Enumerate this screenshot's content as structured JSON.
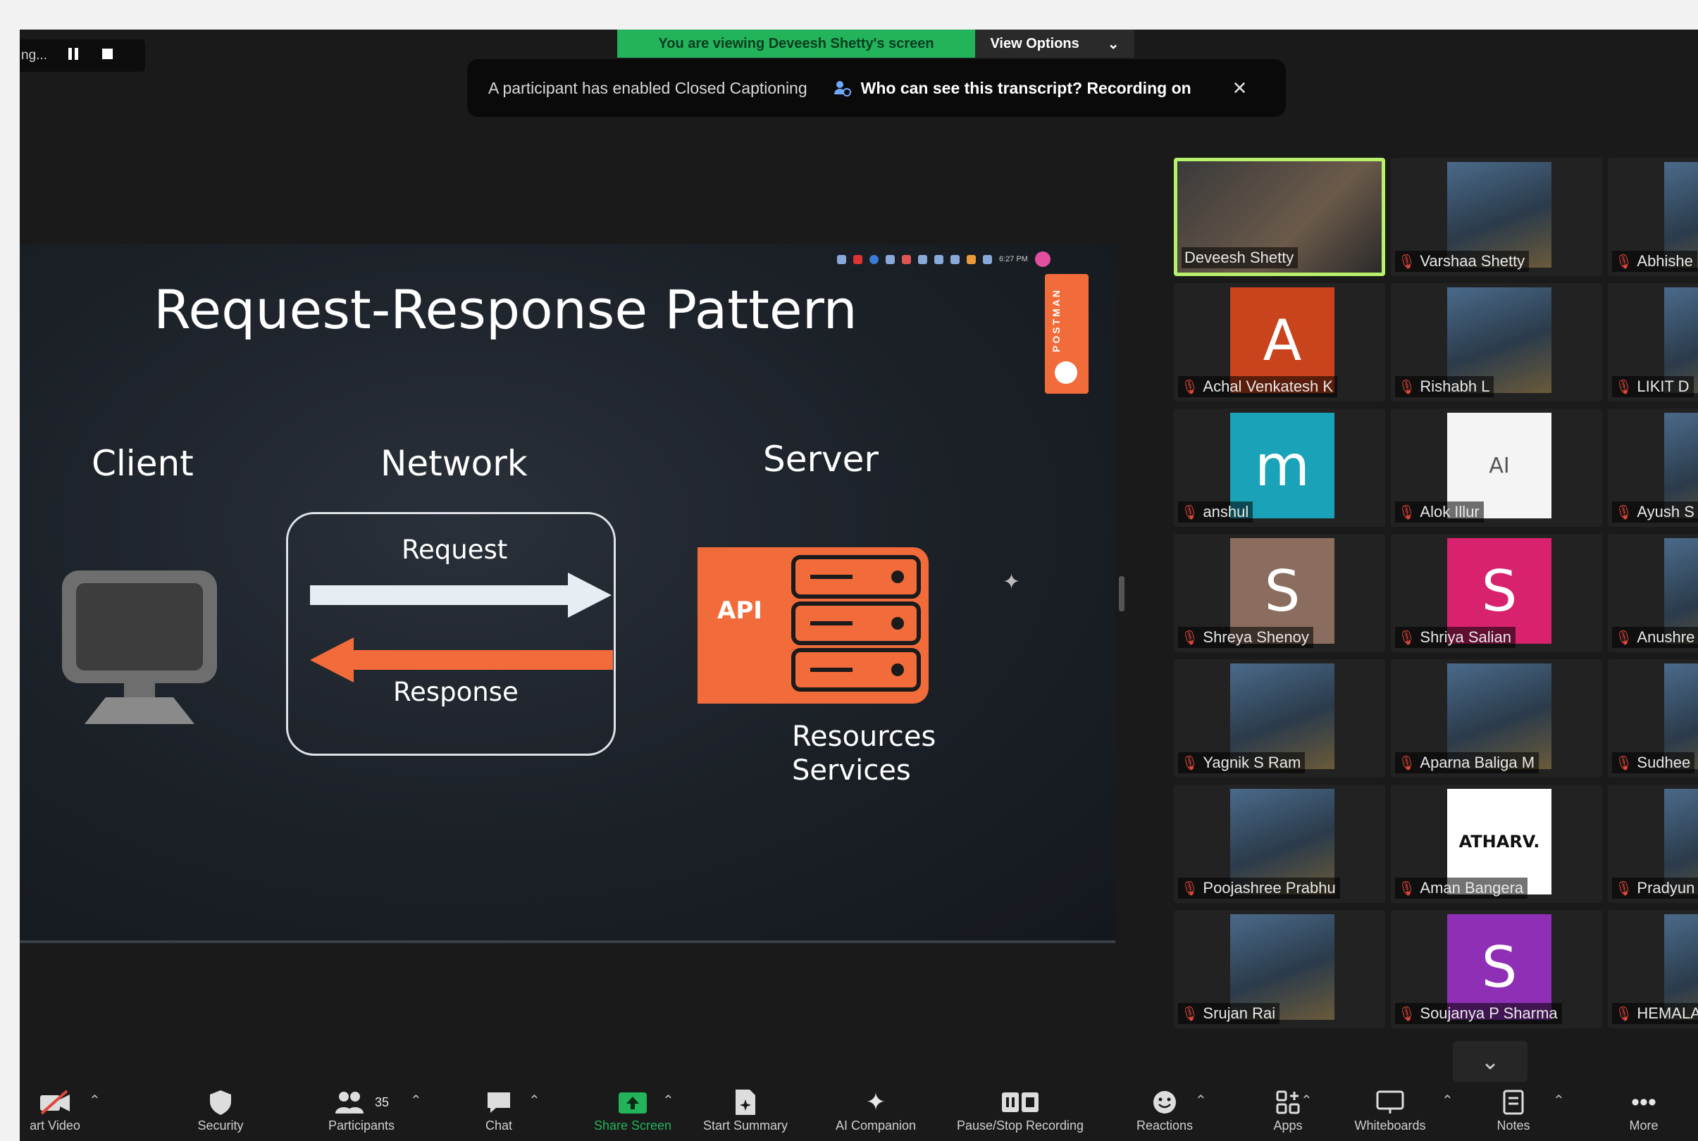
{
  "recording": {
    "status_text": "ng..."
  },
  "share_banner": {
    "viewing": "You are viewing Deveesh Shetty's screen",
    "view_options": "View Options"
  },
  "caption_banner": {
    "message": "A participant has enabled Closed Captioning",
    "question": "Who can see this transcript? Recording on"
  },
  "slide": {
    "title": "Request-Response Pattern",
    "client": "Client",
    "network": "Network",
    "server": "Server",
    "request": "Request",
    "response": "Response",
    "api": "API",
    "resources": "Resources",
    "services": "Services",
    "clock": "6:27 PM",
    "postman": "POSTMAN"
  },
  "participants": [
    {
      "name": "Deveesh Shetty"
    },
    {
      "name": "Varshaa Shetty"
    },
    {
      "name": "Abhishe"
    },
    {
      "name": "Achal Venkatesh K",
      "initial": "A",
      "color": "#c9431c"
    },
    {
      "name": "Rishabh L"
    },
    {
      "name": "LIKIT D"
    },
    {
      "name": "anshul",
      "initial": "m",
      "color": "#1aa3b8"
    },
    {
      "name": "Alok Illur",
      "initial": "AI"
    },
    {
      "name": "Ayush S"
    },
    {
      "name": "Shreya Shenoy",
      "initial": "S",
      "color": "#8a6d5e"
    },
    {
      "name": "Shriya Salian",
      "initial": "S",
      "color": "#d8226e"
    },
    {
      "name": "Anushre"
    },
    {
      "name": "Yagnik S Ram"
    },
    {
      "name": "Aparna Baliga M"
    },
    {
      "name": "Sudhee"
    },
    {
      "name": "Poojashree Prabhu"
    },
    {
      "name": "Aman Bangera",
      "initial": "ATHARV."
    },
    {
      "name": "Pradyun"
    },
    {
      "name": "Srujan Rai"
    },
    {
      "name": "Soujanya P Sharma",
      "initial": "S",
      "color": "#8e2fb6"
    },
    {
      "name": "HEMALA"
    }
  ],
  "toolbar": {
    "start_video": "art Video",
    "security": "Security",
    "participants": "Participants",
    "participants_count": "35",
    "chat": "Chat",
    "share_screen": "Share Screen",
    "start_summary": "Start Summary",
    "ai_companion": "AI Companion",
    "recording": "Pause/Stop Recording",
    "reactions": "Reactions",
    "apps": "Apps",
    "whiteboards": "Whiteboards",
    "notes": "Notes",
    "more": "More"
  },
  "colors": {
    "share_green": "#22b35b",
    "accent_orange": "#f26b3a",
    "active_border": "#b7f06a",
    "muted_red": "#e0463a"
  }
}
